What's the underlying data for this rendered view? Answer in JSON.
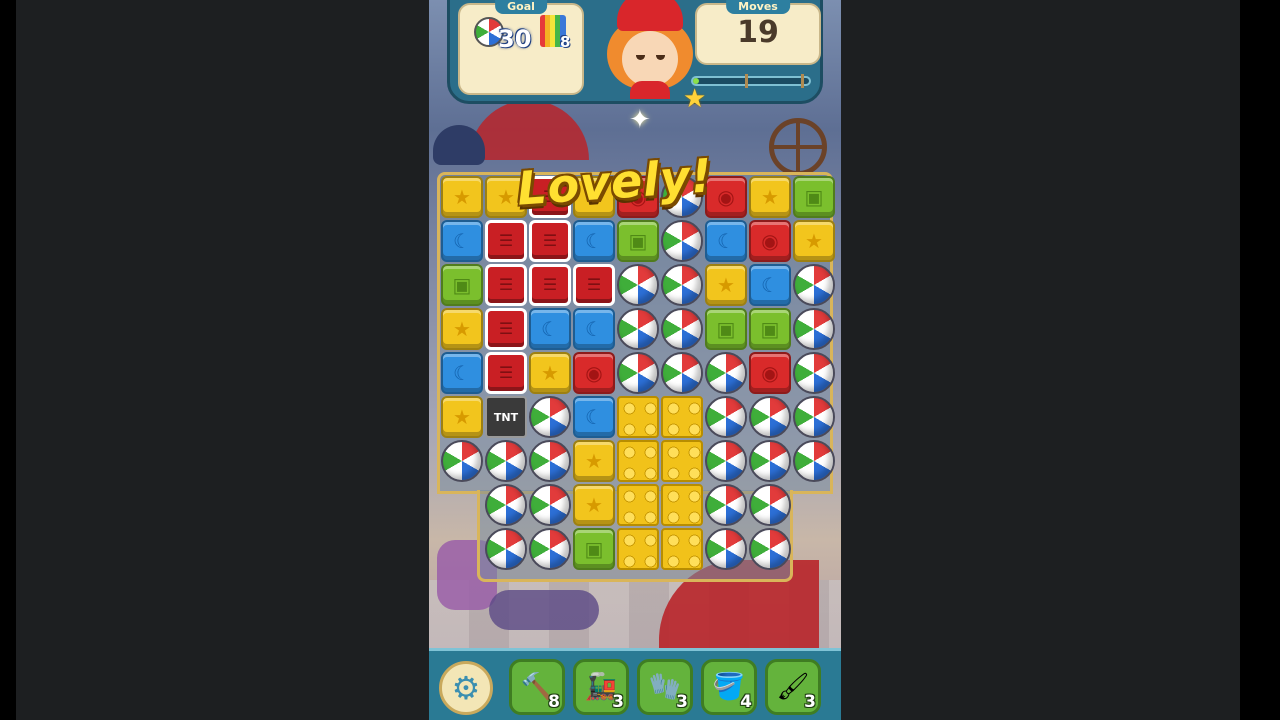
{
  "hud": {
    "goal_title": "Goal",
    "moves_title": "Moves",
    "goal_ball_count": "30",
    "goal_rainbow_count": "8",
    "moves_left": "19",
    "progress_fraction": 0.05
  },
  "popup": {
    "praise_text": "Lovely!"
  },
  "boosters": [
    {
      "name": "hammer-booster",
      "icon": "🔨",
      "count": "8"
    },
    {
      "name": "train-booster",
      "icon": "🚂",
      "count": "3"
    },
    {
      "name": "glove-booster",
      "icon": "🧤",
      "count": "3"
    },
    {
      "name": "bucket-booster",
      "icon": "🪣",
      "count": "4"
    },
    {
      "name": "brush-booster",
      "icon": "🖌",
      "count": "3"
    }
  ],
  "board": {
    "rows": [
      [
        "yellow-star",
        "yellow-star",
        "crate",
        "yellow-star",
        "red-circle",
        "ball",
        "red-circle",
        "yellow-star",
        "green-square"
      ],
      [
        "blue-moon",
        "crate",
        "crate",
        "blue-moon",
        "green-square",
        "ball",
        "blue-moon",
        "red-circle",
        "yellow-star"
      ],
      [
        "green-square",
        "crate",
        "crate",
        "crate",
        "ball",
        "ball",
        "yellow-star",
        "blue-moon",
        "ball"
      ],
      [
        "yellow-star",
        "crate",
        "blue-moon",
        "blue-moon",
        "ball",
        "ball",
        "green-square",
        "green-square",
        "ball"
      ],
      [
        "blue-moon",
        "crate",
        "yellow-star",
        "red-circle",
        "ball",
        "ball",
        "ball",
        "red-circle",
        "ball"
      ],
      [
        "yellow-star",
        "tnt",
        "ball",
        "blue-moon",
        "lego",
        "lego",
        "ball",
        "ball",
        "ball"
      ],
      [
        "ball",
        "ball",
        "ball",
        "yellow-star",
        "lego",
        "lego",
        "ball",
        "ball",
        "ball"
      ],
      [
        "",
        "ball",
        "ball",
        "yellow-star",
        "lego",
        "lego",
        "ball",
        "ball",
        ""
      ],
      [
        "",
        "ball",
        "ball",
        "green-square",
        "lego",
        "lego",
        "ball",
        "ball",
        ""
      ]
    ],
    "tnt_label": "TNT"
  },
  "colors": {
    "yellow": "#f2c51d",
    "red": "#d92a2a",
    "blue": "#2f8fe0",
    "green": "#7bbf2d",
    "board_frame": "#d9b55a",
    "bottom_bar": "#2a7a94"
  }
}
